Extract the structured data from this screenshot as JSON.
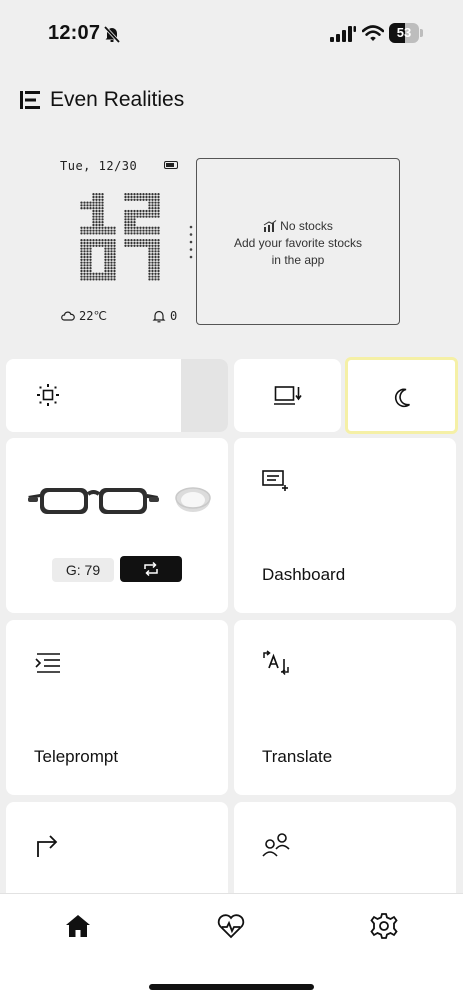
{
  "status_bar": {
    "time": "12:07",
    "battery_percent": "53",
    "battery_level": 0.53
  },
  "brand": {
    "name": "Even Realities"
  },
  "glasses_display": {
    "date": "Tue, 12/30",
    "clock_hour": "12",
    "clock_minute": "07",
    "temperature": "22℃",
    "notification_count": "0",
    "stocks": {
      "title": "No stocks",
      "line1": "Add your favorite stocks",
      "line2": "in the app"
    }
  },
  "controls": {
    "brightness_level": 0.79
  },
  "device": {
    "battery_label": "G: 79"
  },
  "features": {
    "dashboard_label": "Dashboard",
    "teleprompt_label": "Teleprompt",
    "translate_label": "Translate"
  },
  "colors": {
    "background": "#efefef",
    "card": "#ffffff",
    "silent_mode_highlight": "#f5f0a6",
    "text": "#111111"
  },
  "icons": {
    "status": [
      "bell-slash-icon",
      "cellular-signal-icon",
      "wifi-icon",
      "battery-icon"
    ],
    "controls": [
      "sun-icon",
      "display-switch-icon",
      "moon-icon"
    ],
    "features": [
      "dashboard-icon",
      "teleprompt-icon",
      "translate-icon",
      "navigation-arrow-icon",
      "people-icon"
    ],
    "tabs": [
      "home-icon",
      "health-heart-icon",
      "gear-icon"
    ]
  }
}
